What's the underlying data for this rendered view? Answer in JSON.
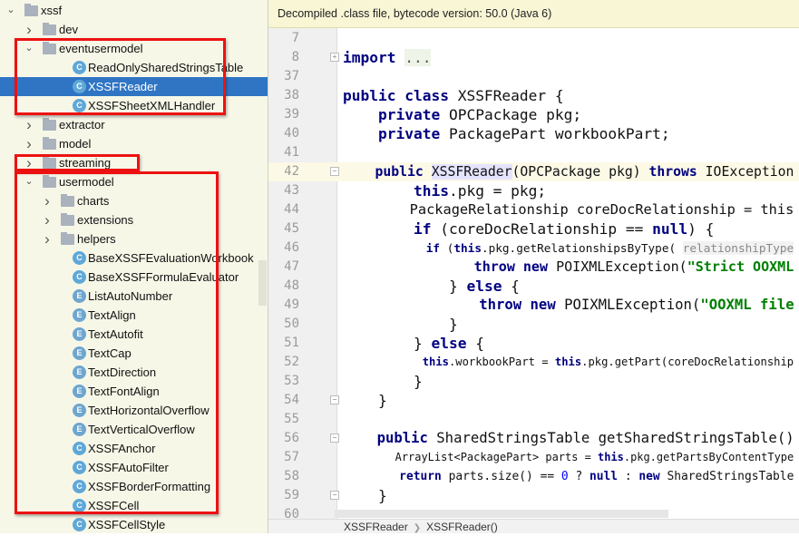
{
  "tree": {
    "items": [
      {
        "label": "xssf",
        "type": "folder",
        "level": 0,
        "expanded": true
      },
      {
        "label": "dev",
        "type": "folder",
        "level": 1,
        "expanded": false
      },
      {
        "label": "eventusermodel",
        "type": "folder",
        "level": 1,
        "expanded": true
      },
      {
        "label": "ReadOnlySharedStringsTable",
        "type": "class",
        "level": 2
      },
      {
        "label": "XSSFReader",
        "type": "class",
        "level": 2,
        "selected": true
      },
      {
        "label": "XSSFSheetXMLHandler",
        "type": "class",
        "level": 2
      },
      {
        "label": "extractor",
        "type": "folder",
        "level": 1,
        "expanded": false
      },
      {
        "label": "model",
        "type": "folder",
        "level": 1,
        "expanded": false
      },
      {
        "label": "streaming",
        "type": "folder",
        "level": 1,
        "expanded": false
      },
      {
        "label": "usermodel",
        "type": "folder",
        "level": 1,
        "expanded": true
      },
      {
        "label": "charts",
        "type": "folder",
        "level": 2,
        "expanded": false
      },
      {
        "label": "extensions",
        "type": "folder",
        "level": 2,
        "expanded": false
      },
      {
        "label": "helpers",
        "type": "folder",
        "level": 2,
        "expanded": false
      },
      {
        "label": "BaseXSSFEvaluationWorkbook",
        "type": "class",
        "level": 2
      },
      {
        "label": "BaseXSSFFormulaEvaluator",
        "type": "class",
        "level": 2
      },
      {
        "label": "ListAutoNumber",
        "type": "enum",
        "level": 2
      },
      {
        "label": "TextAlign",
        "type": "enum",
        "level": 2
      },
      {
        "label": "TextAutofit",
        "type": "enum",
        "level": 2
      },
      {
        "label": "TextCap",
        "type": "enum",
        "level": 2
      },
      {
        "label": "TextDirection",
        "type": "enum",
        "level": 2
      },
      {
        "label": "TextFontAlign",
        "type": "enum",
        "level": 2
      },
      {
        "label": "TextHorizontalOverflow",
        "type": "enum",
        "level": 2
      },
      {
        "label": "TextVerticalOverflow",
        "type": "enum",
        "level": 2
      },
      {
        "label": "XSSFAnchor",
        "type": "class",
        "level": 2
      },
      {
        "label": "XSSFAutoFilter",
        "type": "class",
        "level": 2
      },
      {
        "label": "XSSFBorderFormatting",
        "type": "class",
        "level": 2
      },
      {
        "label": "XSSFCell",
        "type": "class",
        "level": 2
      },
      {
        "label": "XSSFCellStyle",
        "type": "class",
        "level": 2
      }
    ]
  },
  "editor": {
    "notice": "Decompiled .class file, bytecode version: 50.0 (Java 6)",
    "current_line": "42",
    "lines": [
      {
        "n": "7",
        "t": []
      },
      {
        "n": "8",
        "t": [
          [
            "import",
            "kw"
          ],
          [
            " "
          ],
          [
            "...",
            "fold"
          ]
        ]
      },
      {
        "n": "37",
        "t": []
      },
      {
        "n": "38",
        "t": [
          [
            "public class",
            "kw"
          ],
          [
            " XSSFReader {"
          ]
        ]
      },
      {
        "n": "39",
        "t": [
          [
            "    "
          ],
          [
            "private",
            "kw"
          ],
          [
            " OPCPackage pkg;"
          ]
        ]
      },
      {
        "n": "40",
        "t": [
          [
            "    "
          ],
          [
            "private",
            "kw"
          ],
          [
            " PackagePart workbookPart;"
          ]
        ]
      },
      {
        "n": "41",
        "t": []
      },
      {
        "n": "42",
        "t": [
          [
            "    "
          ],
          [
            "public",
            "kw"
          ],
          [
            " "
          ],
          [
            "XSSFReader",
            "hl"
          ],
          [
            "(OPCPackage pkg) "
          ],
          [
            "throws",
            "kw"
          ],
          [
            " IOException"
          ]
        ]
      },
      {
        "n": "43",
        "t": [
          [
            "        "
          ],
          [
            "this",
            "kw"
          ],
          [
            ".pkg = pkg;"
          ]
        ]
      },
      {
        "n": "44",
        "t": [
          [
            "        PackageRelationship coreDocRelationship = this"
          ]
        ]
      },
      {
        "n": "45",
        "t": [
          [
            "        "
          ],
          [
            "if",
            "kw"
          ],
          [
            " (coreDocRelationship == "
          ],
          [
            "null",
            "kw"
          ],
          [
            ") {"
          ]
        ]
      },
      {
        "n": "46",
        "t": [
          [
            "            "
          ],
          [
            "if",
            "kw"
          ],
          [
            " ("
          ],
          [
            "this",
            "kw"
          ],
          [
            ".pkg.getRelationshipsByType( "
          ],
          [
            "relationshipType",
            "hint"
          ]
        ]
      },
      {
        "n": "47",
        "t": [
          [
            "                "
          ],
          [
            "throw new",
            "kw"
          ],
          [
            " POIXMLException("
          ],
          [
            "\"Strict OOXML",
            "str"
          ]
        ]
      },
      {
        "n": "48",
        "t": [
          [
            "            } "
          ],
          [
            "else",
            "kw"
          ],
          [
            " {"
          ]
        ]
      },
      {
        "n": "49",
        "t": [
          [
            "                "
          ],
          [
            "throw new",
            "kw"
          ],
          [
            " POIXMLException("
          ],
          [
            "\"OOXML file",
            "str"
          ]
        ]
      },
      {
        "n": "50",
        "t": [
          [
            "            }"
          ]
        ]
      },
      {
        "n": "51",
        "t": [
          [
            "        } "
          ],
          [
            "else",
            "kw"
          ],
          [
            " {"
          ]
        ]
      },
      {
        "n": "52",
        "t": [
          [
            "            "
          ],
          [
            "this",
            "kw"
          ],
          [
            ".workbookPart = "
          ],
          [
            "this",
            "kw"
          ],
          [
            ".pkg.getPart(coreDocRelationship"
          ]
        ]
      },
      {
        "n": "53",
        "t": [
          [
            "        }"
          ]
        ]
      },
      {
        "n": "54",
        "t": [
          [
            "    }"
          ]
        ]
      },
      {
        "n": "55",
        "t": []
      },
      {
        "n": "56",
        "t": [
          [
            "    "
          ],
          [
            "public",
            "kw"
          ],
          [
            " SharedStringsTable getSharedStringsTable()"
          ]
        ]
      },
      {
        "n": "57",
        "t": [
          [
            "        ArrayList<PackagePart> parts = "
          ],
          [
            "this",
            "kw"
          ],
          [
            ".pkg.getPartsByContentType"
          ]
        ]
      },
      {
        "n": "58",
        "t": [
          [
            "        "
          ],
          [
            "return",
            "kw"
          ],
          [
            " parts.size() == "
          ],
          [
            "0",
            "num"
          ],
          [
            " ? "
          ],
          [
            "null",
            "kw"
          ],
          [
            " : "
          ],
          [
            "new",
            "kw"
          ],
          [
            " SharedStringsTable"
          ]
        ]
      },
      {
        "n": "59",
        "t": [
          [
            "    }"
          ]
        ]
      },
      {
        "n": "60",
        "t": []
      }
    ]
  },
  "breadcrumb": [
    "XSSFReader",
    "XSSFReader()"
  ],
  "colors": {
    "selection": "#2f75c4",
    "highlight_box": "#e11111",
    "keyword": "#000080",
    "string": "#008000"
  }
}
